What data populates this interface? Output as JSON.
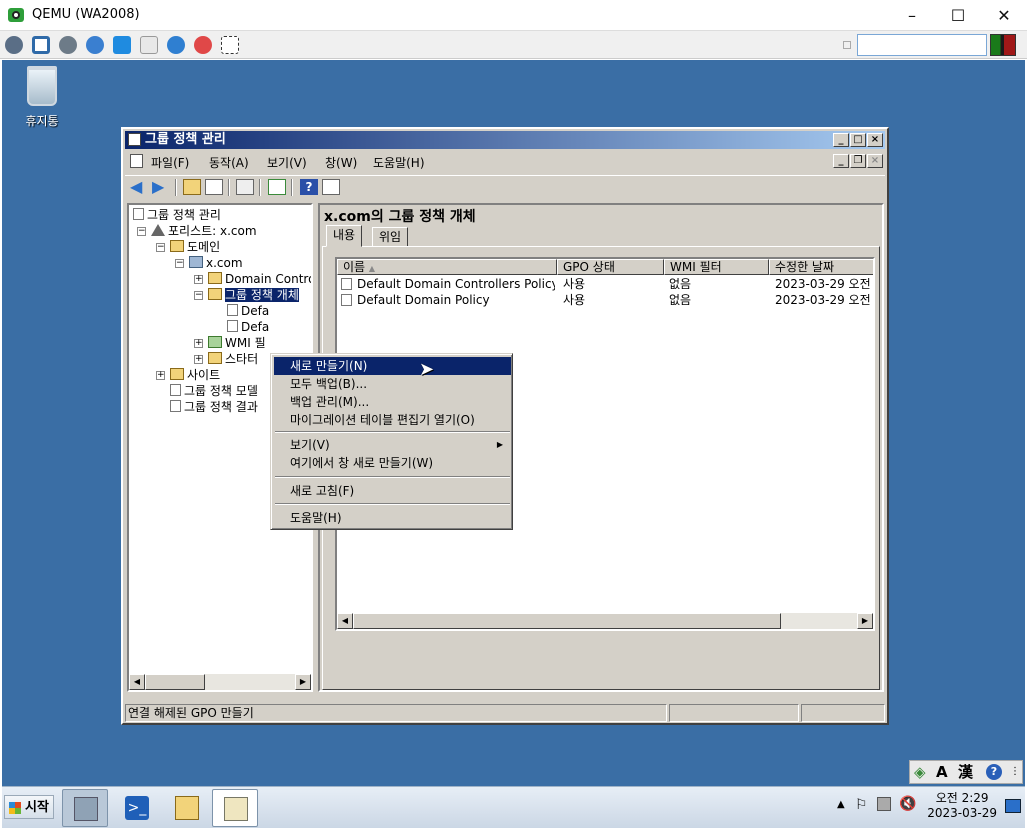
{
  "host": {
    "title": "QEMU (WA2008)",
    "controls": {
      "minimize": "–",
      "maximize": "☐",
      "close": "✕"
    },
    "toolbar_icons": [
      "settings-icon",
      "fullscreen-icon",
      "gear-icon",
      "refresh-icon",
      "windows-icon",
      "disk-icon",
      "info-icon",
      "stop-icon",
      "snapshot-icon"
    ],
    "search_value": ""
  },
  "desktop": {
    "recycle_bin_label": "휴지통"
  },
  "gpmc": {
    "title": "그룹 정책 관리",
    "menu": [
      "파일(F)",
      "동작(A)",
      "보기(V)",
      "창(W)",
      "도움말(H)"
    ],
    "tree": {
      "root": "그룹 정책 관리",
      "forest": "포리스트: x.com",
      "domains": "도메인",
      "domain": "x.com",
      "dc": "Domain Contro",
      "gpo_folder": "그룹 정책 개체",
      "gpo1": "Defa",
      "gpo2": "Defa",
      "wmi": "WMI 필",
      "starter": "스타터",
      "sites": "사이트",
      "modeling": "그룹 정책 모델",
      "results": "그룹 정책 결과"
    },
    "right_title": "x.com의 그룹 정책 개체",
    "tabs": [
      "내용",
      "위임"
    ],
    "columns": [
      "이름",
      "GPO 상태",
      "WMI 필터",
      "수정한 날짜"
    ],
    "rows": [
      {
        "name": "Default Domain Controllers Policy",
        "status": "사용",
        "wmi": "없음",
        "modified": "2023-03-29 오전 ..."
      },
      {
        "name": "Default Domain Policy",
        "status": "사용",
        "wmi": "없음",
        "modified": "2023-03-29 오전 ..."
      }
    ],
    "status_text": "연결 해제된 GPO 만들기"
  },
  "context_menu": {
    "items": [
      "새로 만들기(N)",
      "모두 백업(B)...",
      "백업 관리(M)...",
      "마이그레이션 테이블 편집기 열기(O)"
    ],
    "view": "보기(V)",
    "new_window": "여기에서 창 새로 만들기(W)",
    "refresh": "새로 고침(F)",
    "help": "도움말(H)"
  },
  "langbar": {
    "lang": "A",
    "hanja": "漢",
    "help": "?"
  },
  "taskbar": {
    "start_label": "시작",
    "clock_time": "오전 2:29",
    "clock_date": "2023-03-29"
  },
  "colors": {
    "desktop": "#3a6ea5",
    "title_active": "#0a246a",
    "highlight": "#0a246a",
    "face": "#d4d0c8"
  }
}
